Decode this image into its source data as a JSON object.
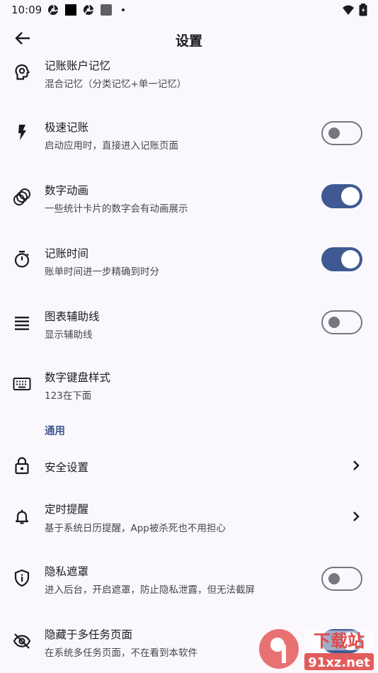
{
  "status": {
    "time": "10:09"
  },
  "appbar": {
    "title": "设置"
  },
  "rows": [
    {
      "title": "记账账户记忆",
      "subtitle": "混合记忆（分类记忆+单一记忆）"
    },
    {
      "title": "极速记账",
      "subtitle": "启动应用时，直接进入记账页面",
      "toggle": false
    },
    {
      "title": "数字动画",
      "subtitle": "一些统计卡片的数字会有动画展示",
      "toggle": true
    },
    {
      "title": "记账时间",
      "subtitle": "账单时间进一步精确到时分",
      "toggle": true
    },
    {
      "title": "图表辅助线",
      "subtitle": "显示辅助线",
      "toggle": false
    },
    {
      "title": "数字键盘样式",
      "subtitle": "123在下面"
    }
  ],
  "section_general": "通用",
  "rows2": [
    {
      "title": "安全设置"
    },
    {
      "title": "定时提醒",
      "subtitle": "基于系统日历提醒，App被杀死也不用担心"
    },
    {
      "title": "隐私遮罩",
      "subtitle": "进入后台，开启遮罩，防止隐私泄露，但无法截屏",
      "toggle": false
    },
    {
      "title": "隐藏于多任务页面",
      "subtitle": "在系统多任务页面，不在看到本软件"
    }
  ],
  "watermark": {
    "main": "下载站",
    "url": "91xz.net"
  },
  "colors": {
    "accent": "#3f5a93",
    "background": "#fbf8fd",
    "outline": "#767680"
  }
}
